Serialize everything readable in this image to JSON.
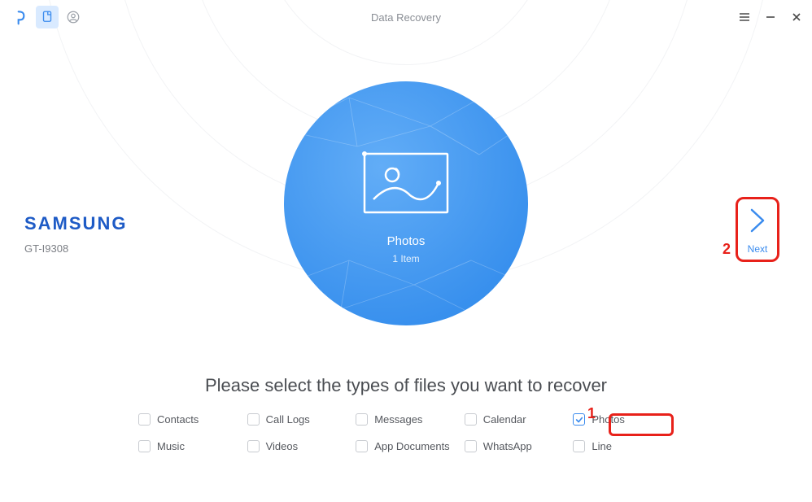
{
  "header": {
    "title": "Data Recovery"
  },
  "device": {
    "brand": "SAMSUNG",
    "model": "GT-I9308"
  },
  "center": {
    "label": "Photos",
    "count": "1 Item"
  },
  "next": {
    "label": "Next"
  },
  "instruction": "Please select the types of files you want to recover",
  "types": [
    {
      "label": "Contacts",
      "checked": false
    },
    {
      "label": "Call Logs",
      "checked": false
    },
    {
      "label": "Messages",
      "checked": false
    },
    {
      "label": "Calendar",
      "checked": false
    },
    {
      "label": "Photos",
      "checked": true
    },
    {
      "label": "Music",
      "checked": false
    },
    {
      "label": "Videos",
      "checked": false
    },
    {
      "label": "App Documents",
      "checked": false
    },
    {
      "label": "WhatsApp",
      "checked": false
    },
    {
      "label": "Line",
      "checked": false
    }
  ],
  "annotations": {
    "num1": "1",
    "num2": "2"
  }
}
